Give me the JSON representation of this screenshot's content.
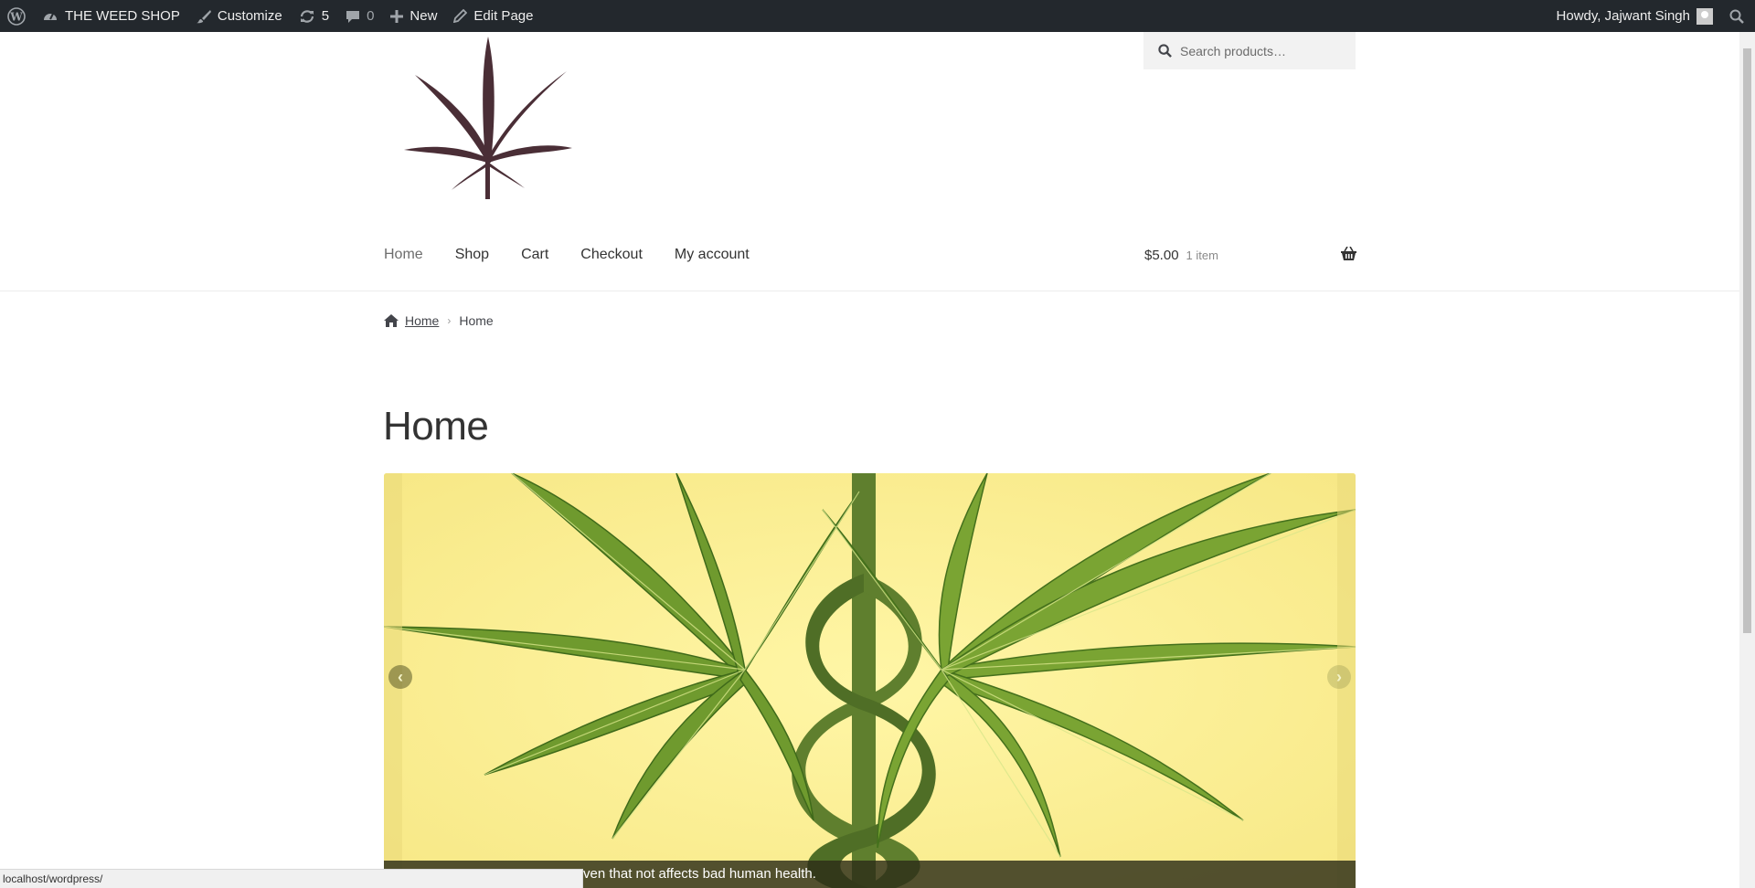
{
  "admin_bar": {
    "site_name": "THE WEED SHOP",
    "customize_label": "Customize",
    "updates_count": "5",
    "comments_count": "0",
    "new_label": "New",
    "edit_page_label": "Edit Page",
    "greeting": "Howdy, Jajwant Singh"
  },
  "header": {
    "search_placeholder": "Search products…",
    "nav": [
      "Home",
      "Shop",
      "Cart",
      "Checkout",
      "My account"
    ],
    "cart_amount": "$5.00",
    "cart_count": "1 item"
  },
  "breadcrumb": {
    "home_link": "Home",
    "current": "Home"
  },
  "page": {
    "title": "Home"
  },
  "slider": {
    "caption": "ven that not affects bad human health.",
    "background_color": "#fbef8e"
  },
  "status_bar": {
    "url": "localhost/wordpress/"
  },
  "colors": {
    "admin_bar_bg": "#23282d",
    "logo_color": "#4a2e36"
  }
}
